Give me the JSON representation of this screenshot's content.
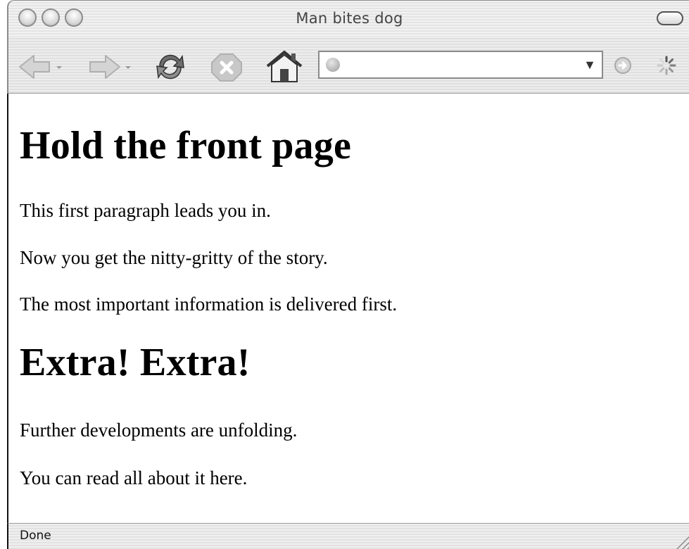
{
  "window": {
    "title": "Man bites dog"
  },
  "toolbar": {
    "url_value": ""
  },
  "content": {
    "heading1": "Hold the front page",
    "paragraph1": "This first paragraph leads you in.",
    "paragraph2": "Now you get the nitty-gritty of the story.",
    "paragraph3": "The most important information is delivered first.",
    "heading2": "Extra! Extra!",
    "paragraph4": "Further developments are unfolding.",
    "paragraph5": "You can read all about it here."
  },
  "status": {
    "text": "Done"
  },
  "icons": {
    "back": "back-arrow-icon",
    "forward": "forward-arrow-icon",
    "reload": "reload-icon",
    "stop": "stop-icon",
    "home": "home-icon",
    "globe": "globe-icon",
    "dropdown": "chevron-down-icon",
    "go": "go-icon",
    "spinner": "spinner-icon"
  }
}
